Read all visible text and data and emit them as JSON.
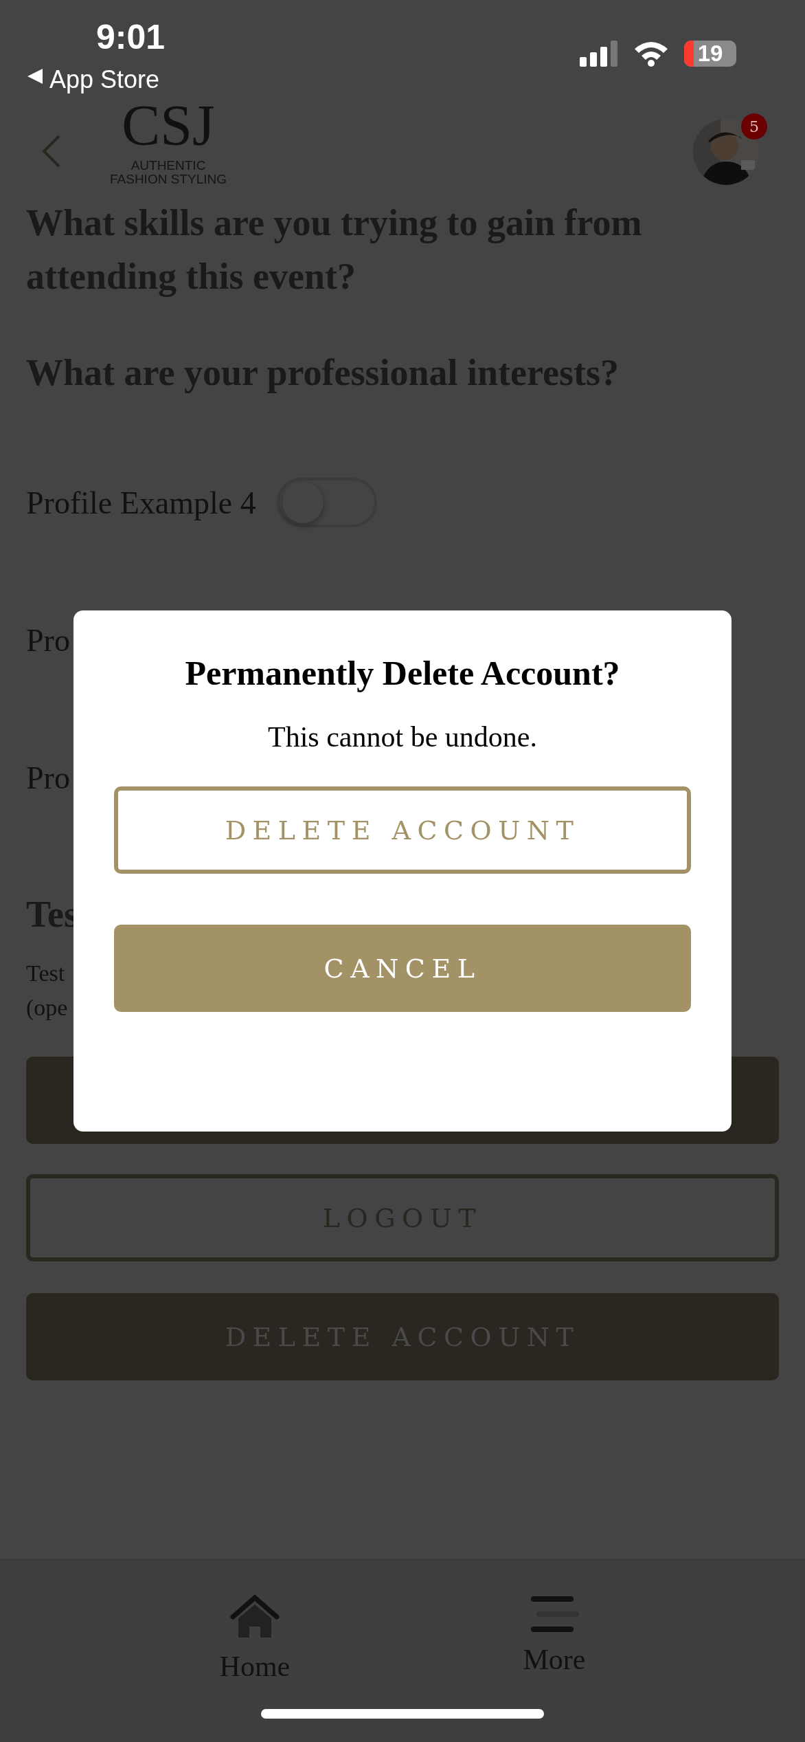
{
  "status_bar": {
    "time": "9:01",
    "back_link": "App Store",
    "battery": "19"
  },
  "header": {
    "logo": {
      "monogram": "CSJ",
      "tagline": [
        "AUTHENTIC",
        "FASHION STYLING"
      ]
    },
    "avatar": {
      "badge": "5"
    }
  },
  "content": [
    {
      "kind": "heading",
      "text": "What skills are you trying to gain from attending this event?"
    },
    {
      "kind": "heading",
      "text": "What are your professional interests?"
    },
    {
      "kind": "toggle",
      "label": "Profile Example 4",
      "on": false
    },
    {
      "kind": "label",
      "label": "Pro"
    },
    {
      "kind": "label",
      "label": "Pro"
    },
    {
      "kind": "heading",
      "text": "Tes"
    },
    {
      "kind": "paragraph",
      "lines": [
        "Test",
        "(ope"
      ]
    },
    {
      "kind": "filled_button"
    },
    {
      "kind": "outline_button",
      "label": "LOGOUT"
    },
    {
      "kind": "filled_button",
      "label": "DELETE ACCOUNT"
    }
  ],
  "dialog": {
    "title": "Permanently Delete Account?",
    "message": "This cannot be undone.",
    "buttons": [
      {
        "kind": "outline",
        "label": "DELETE ACCOUNT"
      },
      {
        "kind": "filled",
        "label": "CANCEL"
      }
    ]
  },
  "tab_bar": [
    {
      "kind": "home",
      "label": "Home"
    },
    {
      "kind": "more",
      "label": "More"
    }
  ]
}
